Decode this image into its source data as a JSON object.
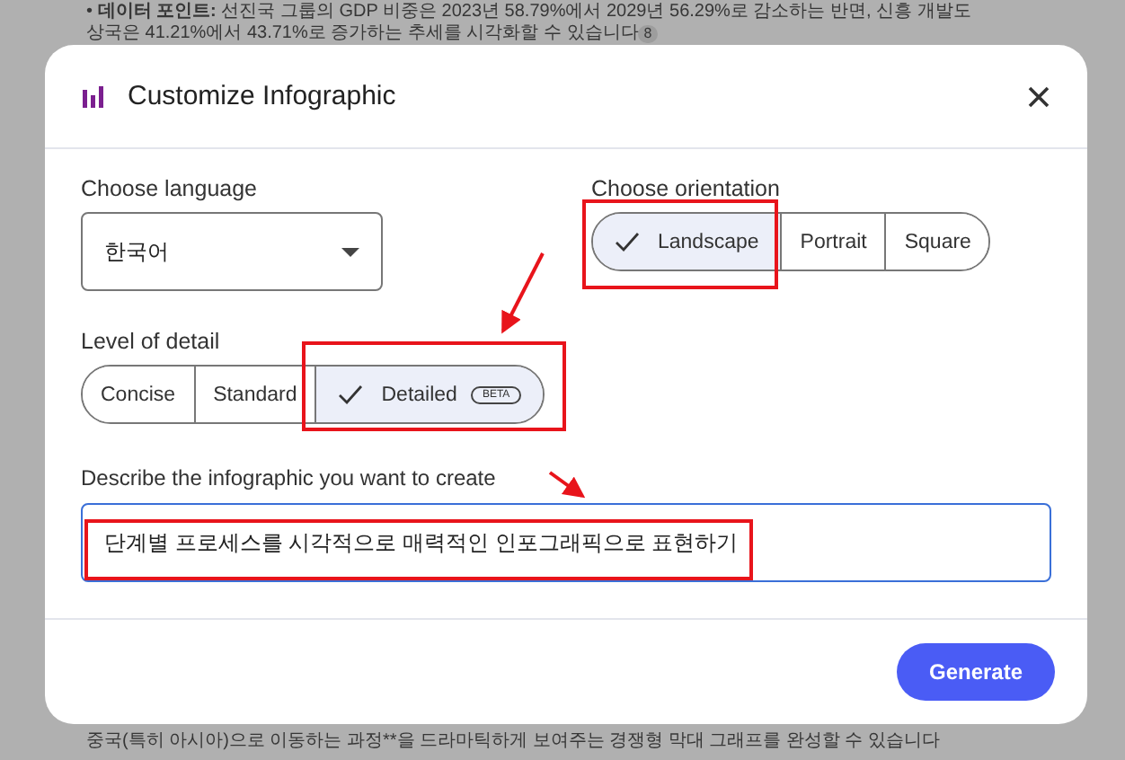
{
  "background": {
    "lines": [
      "• **데이터 포인트:** 선진국 그룹의 GDP 비중은 2023년 58.79%에서 2029년 56.29%로 감소하는 반면, 신흥 개발도",
      "상국은 41.21%에서 43.71%로 증가하는 추세를 시각화할 수 있습니다"
    ],
    "citation": "8",
    "bottom_line": "중국(특히 아시아)으로 이동하는 과정**을 드라마틱하게 보여주는 경쟁형 막대 그래프를 완성할 수 있습니다"
  },
  "dialog": {
    "title": "Customize Infographic",
    "language": {
      "label": "Choose language",
      "value": "한국어"
    },
    "orientation": {
      "label": "Choose orientation",
      "options": [
        {
          "label": "Landscape",
          "selected": true
        },
        {
          "label": "Portrait",
          "selected": false
        },
        {
          "label": "Square",
          "selected": false
        }
      ]
    },
    "detail": {
      "label": "Level of detail",
      "options": [
        {
          "label": "Concise",
          "selected": false
        },
        {
          "label": "Standard",
          "selected": false
        },
        {
          "label": "Detailed",
          "selected": true,
          "badge": "BETA"
        }
      ]
    },
    "description": {
      "label": "Describe the infographic you want to create",
      "value": "단계별 프로세스를 시각적으로 매력적인 인포그래픽으로 표현하기"
    },
    "buttons": [
      "Generate"
    ]
  }
}
